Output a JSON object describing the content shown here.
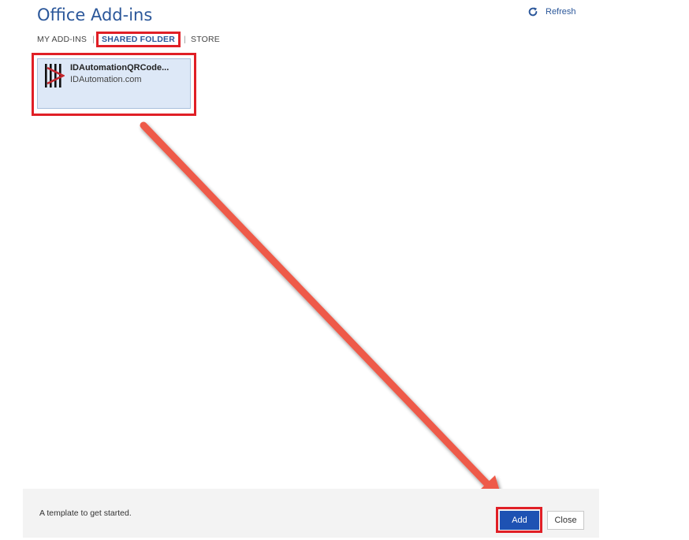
{
  "dialog": {
    "title": "Office Add-ins",
    "refresh_label": "Refresh"
  },
  "tabs": [
    {
      "label": "MY ADD-INS",
      "active": false
    },
    {
      "label": "SHARED FOLDER",
      "active": true
    },
    {
      "label": "STORE",
      "active": false
    }
  ],
  "addins": [
    {
      "name": "IDAutomationQRCode...",
      "publisher": "IDAutomation.com",
      "selected": true
    }
  ],
  "footer": {
    "description": "A template to get started.",
    "add_label": "Add",
    "close_label": "Close"
  },
  "colors": {
    "title_blue": "#2b579a",
    "highlight_red": "#e01f26",
    "arrow": "#ee5a4a",
    "add_button": "#1e52b3",
    "card_selected": "#dde8f7"
  },
  "icons": {
    "refresh": "refresh-icon",
    "addin_logo": "idautomation-logo-icon"
  }
}
